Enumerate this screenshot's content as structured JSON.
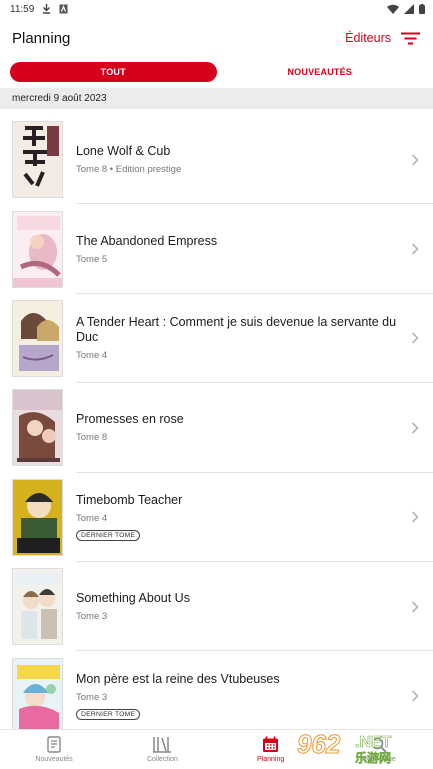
{
  "status": {
    "time": "11:59"
  },
  "header": {
    "title": "Planning",
    "publishers_label": "Éditeurs"
  },
  "tabs": [
    {
      "label": "TOUT"
    },
    {
      "label": "NOUVEAUTÉS"
    }
  ],
  "date_header": "mercredi 9 août 2023",
  "items": [
    {
      "title": "Lone Wolf & Cub",
      "subtitle": "Tome 8 • Edition prestige",
      "badge": ""
    },
    {
      "title": "The Abandoned Empress",
      "subtitle": "Tome 5",
      "badge": ""
    },
    {
      "title": "A Tender Heart : Comment je suis devenue la servante du Duc",
      "subtitle": "Tome 4",
      "badge": ""
    },
    {
      "title": "Promesses en rose",
      "subtitle": "Tome 8",
      "badge": ""
    },
    {
      "title": "Timebomb Teacher",
      "subtitle": "Tome 4",
      "badge": "DERNIER TOME"
    },
    {
      "title": "Something About Us",
      "subtitle": "Tome 3",
      "badge": ""
    },
    {
      "title": "Mon père est la reine des Vtubeuses",
      "subtitle": "Tome 3",
      "badge": "DERNIER TOME"
    }
  ],
  "bottom_nav": [
    {
      "label": "Nouveautés",
      "icon": "book-icon"
    },
    {
      "label": "Collection",
      "icon": "shelf-icon"
    },
    {
      "label": "Planning",
      "icon": "calendar-icon",
      "active": true
    },
    {
      "label": "Recherche",
      "icon": "search-icon"
    }
  ],
  "watermark": {
    "number": "962",
    "suffix": ".NET",
    "text": "乐游网"
  },
  "colors": {
    "accent": "#d6001c",
    "date_header_bg": "#ececec"
  }
}
